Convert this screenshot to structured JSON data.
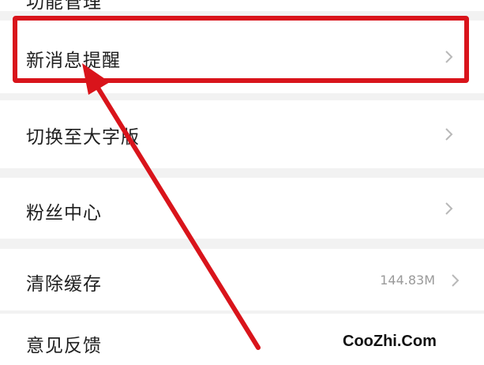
{
  "settings": {
    "items": [
      {
        "label": "功能管理",
        "has_chevron": false
      },
      {
        "label": "新消息提醒",
        "has_chevron": true
      },
      {
        "label": "切换至大字版",
        "has_chevron": true
      },
      {
        "label": "粉丝中心",
        "has_chevron": true
      },
      {
        "label": "清除缓存",
        "value": "144.83M",
        "has_chevron": true
      },
      {
        "label": "意见反馈",
        "has_chevron": false
      }
    ]
  },
  "annotation": {
    "highlight_color": "#d9141b",
    "arrow_color": "#d9141b"
  },
  "watermark": "CooZhi.Com"
}
